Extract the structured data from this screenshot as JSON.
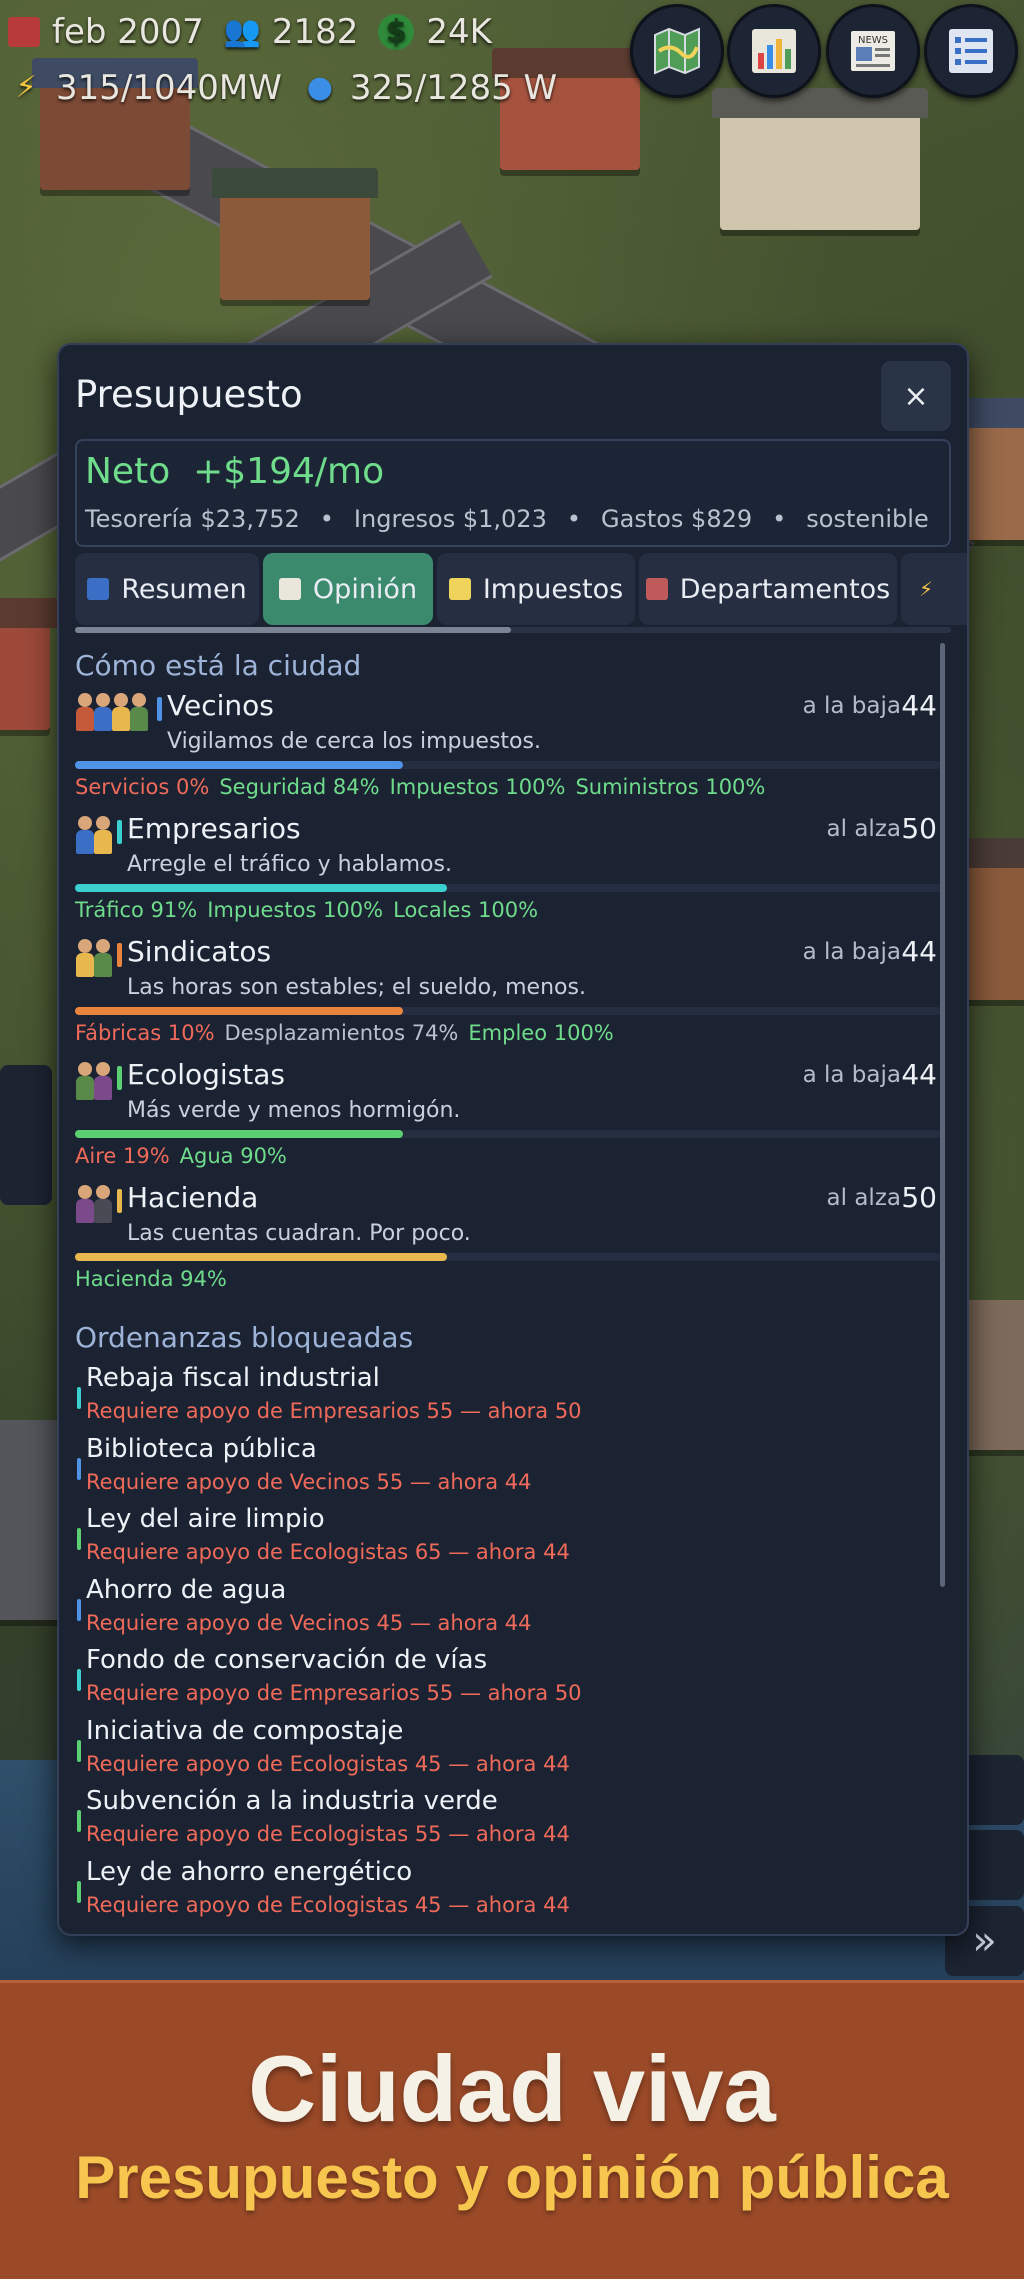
{
  "hud": {
    "date": "feb 2007",
    "population": "2182",
    "money": "24K",
    "power": "315/1040MW",
    "water": "325/1285 W",
    "buttons": [
      {
        "icon": "map-icon"
      },
      {
        "icon": "bar-chart-icon"
      },
      {
        "icon": "newspaper-icon",
        "label": "NEWS"
      },
      {
        "icon": "list-menu-icon"
      }
    ]
  },
  "panel": {
    "title": "Presupuesto",
    "close_label": "×",
    "net": {
      "label": "Neto",
      "value": "+$194/mo",
      "treasury": "Tesorería $23,752",
      "income": "Ingresos $1,023",
      "expenses": "Gastos $829",
      "status": "sostenible",
      "separator": "•"
    },
    "tabs": [
      {
        "label": "Resumen",
        "active": false
      },
      {
        "label": "Opinión",
        "active": true
      },
      {
        "label": "Impuestos",
        "active": false
      },
      {
        "label": "Departamentos",
        "active": false
      }
    ],
    "opinion_heading": "Cómo está la ciudad",
    "groups": [
      {
        "name": "Vecinos",
        "quote": "Vigilamos de cerca los impuestos.",
        "trend": "a la baja",
        "score": "44",
        "approval_pct": 44,
        "color": "#4f93e6",
        "factors": [
          {
            "text": "Servicios 0%",
            "color": "#f06a5a"
          },
          {
            "text": "Seguridad 84%",
            "color": "#6fdc8c"
          },
          {
            "text": "Impuestos 100%",
            "color": "#6fdc8c"
          },
          {
            "text": "Suministros 100%",
            "color": "#6fdc8c"
          }
        ]
      },
      {
        "name": "Empresarios",
        "quote": "Arregle el tráfico y hablamos.",
        "trend": "al alza",
        "score": "50",
        "approval_pct": 50,
        "color": "#3ccfcf",
        "factors": [
          {
            "text": "Tráfico 91%",
            "color": "#6fdc8c"
          },
          {
            "text": "Impuestos 100%",
            "color": "#6fdc8c"
          },
          {
            "text": "Locales 100%",
            "color": "#6fdc8c"
          }
        ]
      },
      {
        "name": "Sindicatos",
        "quote": "Las horas son estables; el sueldo, menos.",
        "trend": "a la baja",
        "score": "44",
        "approval_pct": 44,
        "color": "#e8843e",
        "factors": [
          {
            "text": "Fábricas 10%",
            "color": "#f06a5a"
          },
          {
            "text": "Desplazamientos 74%",
            "color": "#b9c1cf"
          },
          {
            "text": "Empleo 100%",
            "color": "#6fdc8c"
          }
        ]
      },
      {
        "name": "Ecologistas",
        "quote": "Más verde y menos hormigón.",
        "trend": "a la baja",
        "score": "44",
        "approval_pct": 44,
        "color": "#5ccf72",
        "factors": [
          {
            "text": "Aire 19%",
            "color": "#f06a5a"
          },
          {
            "text": "Agua 90%",
            "color": "#6fdc8c"
          }
        ]
      },
      {
        "name": "Hacienda",
        "quote": "Las cuentas cuadran. Por poco.",
        "trend": "al alza",
        "score": "50",
        "approval_pct": 50,
        "color": "#e8b84e",
        "factors": [
          {
            "text": "Hacienda 94%",
            "color": "#6fdc8c"
          }
        ]
      }
    ],
    "ordinances_heading": "Ordenanzas bloqueadas",
    "ordinances": [
      {
        "name": "Rebaja fiscal industrial",
        "requirement": "Requiere apoyo de Empresarios 55 — ahora 50",
        "color": "#3ccfcf"
      },
      {
        "name": "Biblioteca pública",
        "requirement": "Requiere apoyo de Vecinos 55 — ahora 44",
        "color": "#4f93e6"
      },
      {
        "name": "Ley del aire limpio",
        "requirement": "Requiere apoyo de Ecologistas 65 — ahora 44",
        "color": "#5ccf72"
      },
      {
        "name": "Ahorro de agua",
        "requirement": "Requiere apoyo de Vecinos 45 — ahora 44",
        "color": "#4f93e6"
      },
      {
        "name": "Fondo de conservación de vías",
        "requirement": "Requiere apoyo de Empresarios 55 — ahora 50",
        "color": "#3ccfcf"
      },
      {
        "name": "Iniciativa de compostaje",
        "requirement": "Requiere apoyo de Ecologistas 45 — ahora 44",
        "color": "#5ccf72"
      },
      {
        "name": "Subvención a la industria verde",
        "requirement": "Requiere apoyo de Ecologistas 55 — ahora 44",
        "color": "#5ccf72"
      },
      {
        "name": "Ley de ahorro energético",
        "requirement": "Requiere apoyo de Ecologistas 45 — ahora 44",
        "color": "#5ccf72"
      }
    ]
  },
  "banner": {
    "title": "Ciudad viva",
    "subtitle": "Presupuesto y opinión pública"
  }
}
